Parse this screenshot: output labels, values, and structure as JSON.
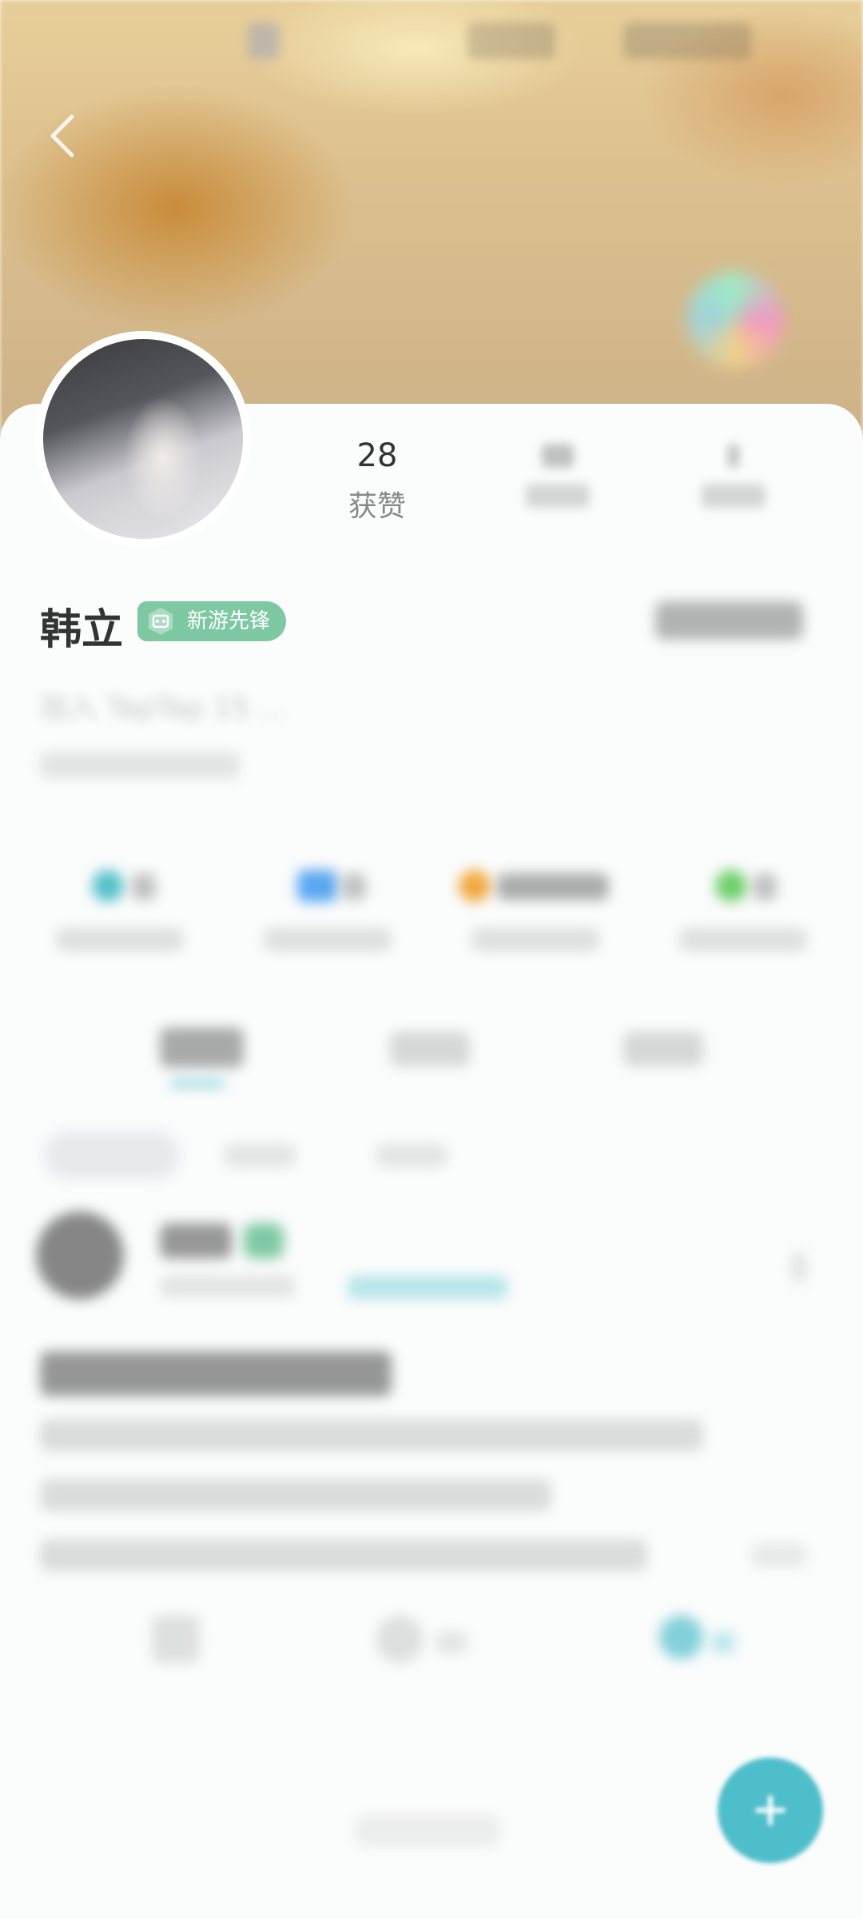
{
  "profile": {
    "name": "韩立",
    "badge_label": "新游先锋",
    "stats": [
      {
        "value": "28",
        "label": "获赞"
      },
      {
        "value": "",
        "label": ""
      },
      {
        "value": "",
        "label": ""
      }
    ],
    "join_info": "加入 TapTap 15 ..."
  },
  "tabs": [],
  "colors": {
    "accent": "#4fbecb",
    "badge": "#7ec9a3"
  }
}
